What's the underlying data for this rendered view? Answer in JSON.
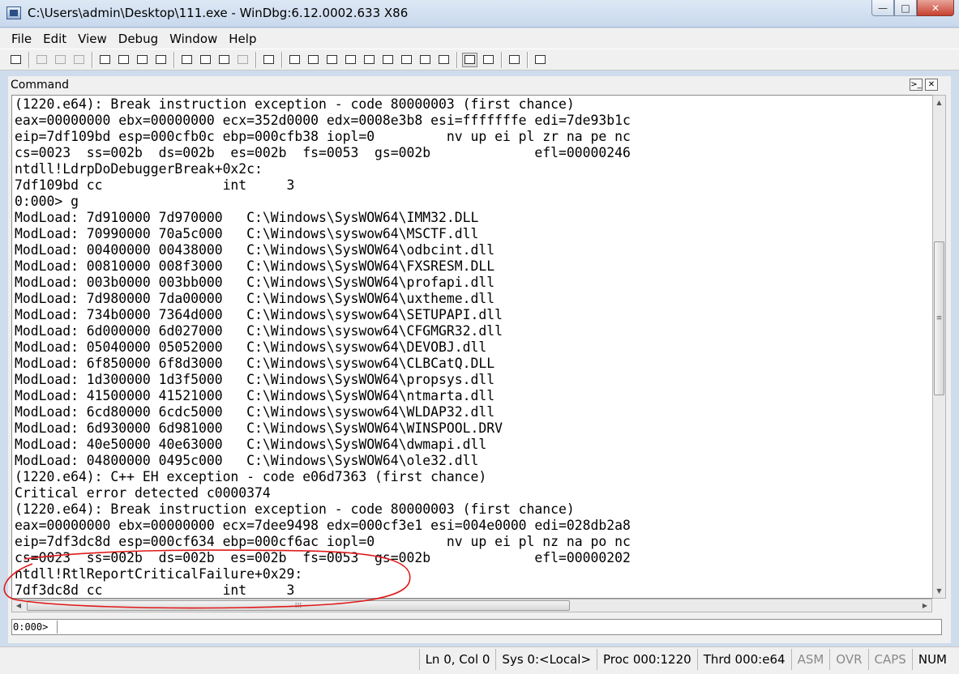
{
  "window": {
    "title": "C:\\Users\\admin\\Desktop\\111.exe - WinDbg:6.12.0002.633 X86",
    "min_glyph": "—",
    "max_glyph": "□",
    "close_glyph": "✕"
  },
  "menu": [
    "File",
    "Edit",
    "View",
    "Debug",
    "Window",
    "Help"
  ],
  "command_window": {
    "title": "Command",
    "lines": [
      "(1220.e64): Break instruction exception - code 80000003 (first chance)",
      "eax=00000000 ebx=00000000 ecx=352d0000 edx=0008e3b8 esi=fffffffe edi=7de93b1c",
      "eip=7df109bd esp=000cfb0c ebp=000cfb38 iopl=0         nv up ei pl zr na pe nc",
      "cs=0023  ss=002b  ds=002b  es=002b  fs=0053  gs=002b             efl=00000246",
      "ntdll!LdrpDoDebuggerBreak+0x2c:",
      "7df109bd cc               int     3",
      "0:000> g",
      "ModLoad: 7d910000 7d970000   C:\\Windows\\SysWOW64\\IMM32.DLL",
      "ModLoad: 70990000 70a5c000   C:\\Windows\\syswow64\\MSCTF.dll",
      "ModLoad: 00400000 00438000   C:\\Windows\\SysWOW64\\odbcint.dll",
      "ModLoad: 00810000 008f3000   C:\\Windows\\SysWOW64\\FXSRESM.DLL",
      "ModLoad: 003b0000 003bb000   C:\\Windows\\SysWOW64\\profapi.dll",
      "ModLoad: 7d980000 7da00000   C:\\Windows\\SysWOW64\\uxtheme.dll",
      "ModLoad: 734b0000 7364d000   C:\\Windows\\syswow64\\SETUPAPI.dll",
      "ModLoad: 6d000000 6d027000   C:\\Windows\\syswow64\\CFGMGR32.dll",
      "ModLoad: 05040000 05052000   C:\\Windows\\syswow64\\DEVOBJ.dll",
      "ModLoad: 6f850000 6f8d3000   C:\\Windows\\syswow64\\CLBCatQ.DLL",
      "ModLoad: 1d300000 1d3f5000   C:\\Windows\\SysWOW64\\propsys.dll",
      "ModLoad: 41500000 41521000   C:\\Windows\\SysWOW64\\ntmarta.dll",
      "ModLoad: 6cd80000 6cdc5000   C:\\Windows\\syswow64\\WLDAP32.dll",
      "ModLoad: 6d930000 6d981000   C:\\Windows\\SysWOW64\\WINSPOOL.DRV",
      "ModLoad: 40e50000 40e63000   C:\\Windows\\SysWOW64\\dwmapi.dll",
      "ModLoad: 04800000 0495c000   C:\\Windows\\SysWOW64\\ole32.dll",
      "(1220.e64): C++ EH exception - code e06d7363 (first chance)",
      "Critical error detected c0000374",
      "(1220.e64): Break instruction exception - code 80000003 (first chance)",
      "eax=00000000 ebx=00000000 ecx=7dee9498 edx=000cf3e1 esi=004e0000 edi=028db2a8",
      "eip=7df3dc8d esp=000cf634 ebp=000cf6ac iopl=0         nv up ei pl nz na po nc",
      "cs=0023  ss=002b  ds=002b  es=002b  fs=0053  gs=002b             efl=00000202",
      "ntdll!RtlReportCriticalFailure+0x29:",
      "7df3dc8d cc               int     3"
    ],
    "prompt": "0:000>",
    "input_value": ""
  },
  "status": {
    "position": "Ln 0, Col 0",
    "system": "Sys 0:<Local>",
    "process": "Proc 000:1220",
    "thread": "Thrd 000:e64",
    "asm": "ASM",
    "ovr": "OVR",
    "caps": "CAPS",
    "num": "NUM"
  },
  "colors": {
    "annotation": "#e01a1a",
    "output_bg": "#ffffff",
    "chrome_bg": "#f0f0f0"
  }
}
